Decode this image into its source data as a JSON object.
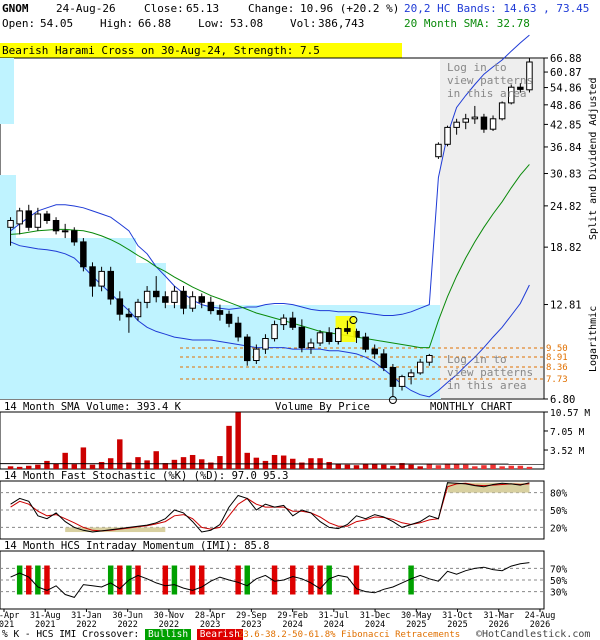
{
  "header": {
    "symbol": "GNOM",
    "date": "24-Aug-26",
    "close_label": "Close:",
    "close": "65.13",
    "change_label": "Change:",
    "change": "10.96 (+20.2 %)",
    "open_label": "Open:",
    "open": "54.05",
    "high_label": "High:",
    "high": "66.88",
    "low_label": "Low:",
    "low": "53.08",
    "vol_label": "Vol:",
    "vol": "386,743",
    "bands": "20,2 HC Bands: 14.63 , 73.45",
    "sma": "20 Month SMA: 32.78"
  },
  "colors": {
    "upper_band": "#1f3bd6",
    "lower_band": "#1f3bd6",
    "sma": "#0a8a0a",
    "up_candle": "#ffffff",
    "down_candle": "#000000",
    "volume_bar": "#cc0000",
    "cyan_zone": "#bff3ff",
    "bullish": "#00a000",
    "bearish": "#dd0000",
    "fib": "#e07000"
  },
  "alert": "Bearish Harami Cross on 30-Aug-24, Strength: 7.5",
  "main_panel": {
    "side_label": "Split and Dividend Adjusted",
    "log_label": "Logarithmic",
    "login_text_top": [
      "Log in to",
      "view patterns",
      "in this area"
    ],
    "login_text_bottom": [
      "Log in to",
      "view patterns",
      "in this area"
    ],
    "volume_by_price_label": "Volume By Price",
    "monthly_chart_label": "MONTHLY CHART",
    "fib_levels": [
      "9.50",
      "8.91",
      "8.36",
      "7.73"
    ]
  },
  "volume_panel": {
    "label": "14 Month SMA Volume: 393.4 K",
    "ticks": [
      "10.57 M",
      "7.05 M",
      "3.52 M"
    ]
  },
  "stoch_panel": {
    "label": "14 Month Fast Stochastic (%K) (%D): 97.0   95.3",
    "ticks": [
      "80%",
      "50%",
      "20%"
    ]
  },
  "imi_panel": {
    "label": "14 Month HCS Intraday Momentum (IMI): 85.8",
    "ticks": [
      "70%",
      "50%",
      "30%"
    ]
  },
  "x_axis": {
    "ticks": [
      "30-Apr\n2021",
      "31-Aug\n2021",
      "31-Jan\n2022",
      "30-Jun\n2022",
      "30-Nov\n2022",
      "28-Apr\n2023",
      "29-Sep\n2023",
      "29-Feb\n2024",
      "31-Jul\n2024",
      "31-Dec\n2024",
      "30-May\n2025",
      "31-Oct\n2025",
      "31-Mar\n2026",
      "24-Aug\n2026"
    ]
  },
  "footer": {
    "legend_text": "% K - HCS IMI Crossover:",
    "bullish": "Bullish",
    "bearish": "Bearish",
    "fib_text": "23.6-38.2-50-61.8% Fibonacci Retracements",
    "copyright": "©HotCandlestick.com"
  },
  "chart_data": {
    "type": "candlestick",
    "title": "GNOM",
    "scale": "logarithmic",
    "ylim": [
      6.8,
      66.88
    ],
    "y_ticks": [
      66.88,
      60.87,
      54.86,
      48.86,
      42.85,
      36.84,
      30.83,
      24.82,
      18.82,
      12.81,
      6.8
    ],
    "ohlc": [
      {
        "o": 21.5,
        "h": 23.0,
        "l": 19.0,
        "c": 22.5
      },
      {
        "o": 22.0,
        "h": 24.5,
        "l": 20.5,
        "c": 24.0
      },
      {
        "o": 24.0,
        "h": 25.0,
        "l": 21.0,
        "c": 21.5
      },
      {
        "o": 21.5,
        "h": 24.5,
        "l": 21.0,
        "c": 23.5
      },
      {
        "o": 23.5,
        "h": 24.0,
        "l": 22.0,
        "c": 22.5
      },
      {
        "o": 22.5,
        "h": 23.0,
        "l": 20.5,
        "c": 21.0
      },
      {
        "o": 21.0,
        "h": 22.0,
        "l": 20.0,
        "c": 21.0
      },
      {
        "o": 21.0,
        "h": 21.5,
        "l": 19.0,
        "c": 19.5
      },
      {
        "o": 19.5,
        "h": 20.0,
        "l": 16.0,
        "c": 16.5
      },
      {
        "o": 16.5,
        "h": 17.0,
        "l": 13.5,
        "c": 14.5
      },
      {
        "o": 14.5,
        "h": 16.5,
        "l": 14.0,
        "c": 16.0
      },
      {
        "o": 16.0,
        "h": 16.5,
        "l": 12.8,
        "c": 13.3
      },
      {
        "o": 13.3,
        "h": 14.0,
        "l": 11.5,
        "c": 12.0
      },
      {
        "o": 12.0,
        "h": 12.5,
        "l": 10.6,
        "c": 11.8
      },
      {
        "o": 11.8,
        "h": 13.3,
        "l": 11.5,
        "c": 13.0
      },
      {
        "o": 13.0,
        "h": 14.5,
        "l": 12.5,
        "c": 14.0
      },
      {
        "o": 14.0,
        "h": 15.5,
        "l": 13.0,
        "c": 13.5
      },
      {
        "o": 13.5,
        "h": 14.0,
        "l": 12.5,
        "c": 13.0
      },
      {
        "o": 13.0,
        "h": 14.5,
        "l": 12.5,
        "c": 14.0
      },
      {
        "o": 14.0,
        "h": 14.5,
        "l": 12.0,
        "c": 12.5
      },
      {
        "o": 12.5,
        "h": 14.0,
        "l": 12.2,
        "c": 13.5
      },
      {
        "o": 13.5,
        "h": 13.8,
        "l": 12.5,
        "c": 13.0
      },
      {
        "o": 13.0,
        "h": 13.5,
        "l": 12.0,
        "c": 12.3
      },
      {
        "o": 12.3,
        "h": 12.8,
        "l": 11.5,
        "c": 12.0
      },
      {
        "o": 12.0,
        "h": 12.3,
        "l": 11.0,
        "c": 11.3
      },
      {
        "o": 11.3,
        "h": 11.8,
        "l": 10.0,
        "c": 10.3
      },
      {
        "o": 10.3,
        "h": 10.5,
        "l": 8.5,
        "c": 8.8
      },
      {
        "o": 8.8,
        "h": 9.8,
        "l": 8.6,
        "c": 9.5
      },
      {
        "o": 9.5,
        "h": 10.5,
        "l": 9.2,
        "c": 10.2
      },
      {
        "o": 10.2,
        "h": 11.5,
        "l": 10.0,
        "c": 11.2
      },
      {
        "o": 11.2,
        "h": 12.0,
        "l": 10.8,
        "c": 11.7
      },
      {
        "o": 11.7,
        "h": 12.2,
        "l": 10.8,
        "c": 11.0
      },
      {
        "o": 11.0,
        "h": 11.6,
        "l": 9.3,
        "c": 9.6
      },
      {
        "o": 9.6,
        "h": 10.2,
        "l": 9.2,
        "c": 9.9
      },
      {
        "o": 9.9,
        "h": 10.8,
        "l": 9.7,
        "c": 10.6
      },
      {
        "o": 10.6,
        "h": 11.0,
        "l": 9.8,
        "c": 10.0
      },
      {
        "o": 10.0,
        "h": 11.0,
        "l": 9.8,
        "c": 10.9
      },
      {
        "o": 10.9,
        "h": 11.5,
        "l": 10.5,
        "c": 10.7
      },
      {
        "o": 10.7,
        "h": 10.9,
        "l": 9.9,
        "c": 10.3
      },
      {
        "o": 10.3,
        "h": 10.6,
        "l": 9.3,
        "c": 9.5
      },
      {
        "o": 9.5,
        "h": 9.8,
        "l": 8.9,
        "c": 9.2
      },
      {
        "o": 9.2,
        "h": 9.5,
        "l": 8.2,
        "c": 8.4
      },
      {
        "o": 8.4,
        "h": 8.6,
        "l": 6.9,
        "c": 7.4
      },
      {
        "o": 7.4,
        "h": 8.0,
        "l": 7.2,
        "c": 7.9
      },
      {
        "o": 7.9,
        "h": 8.3,
        "l": 7.5,
        "c": 8.1
      },
      {
        "o": 8.1,
        "h": 8.9,
        "l": 8.0,
        "c": 8.7
      },
      {
        "o": 8.7,
        "h": 9.2,
        "l": 8.5,
        "c": 9.1
      },
      {
        "o": 34.5,
        "h": 38.0,
        "l": 34.0,
        "c": 37.5
      },
      {
        "o": 37.5,
        "h": 42.5,
        "l": 37.0,
        "c": 42.0
      },
      {
        "o": 42.0,
        "h": 44.5,
        "l": 40.0,
        "c": 43.5
      },
      {
        "o": 43.5,
        "h": 46.0,
        "l": 41.5,
        "c": 44.5
      },
      {
        "o": 44.5,
        "h": 48.5,
        "l": 43.0,
        "c": 45.0
      },
      {
        "o": 45.0,
        "h": 46.0,
        "l": 40.5,
        "c": 41.5
      },
      {
        "o": 41.5,
        "h": 45.5,
        "l": 41.0,
        "c": 44.5
      },
      {
        "o": 44.5,
        "h": 50.0,
        "l": 44.0,
        "c": 49.5
      },
      {
        "o": 49.5,
        "h": 56.0,
        "l": 49.0,
        "c": 55.0
      },
      {
        "o": 55.0,
        "h": 56.5,
        "l": 53.0,
        "c": 54.2
      },
      {
        "o": 54.05,
        "h": 66.88,
        "l": 53.08,
        "c": 65.13
      }
    ],
    "volume_ylim": [
      0,
      10.57
    ],
    "volume": [
      0.5,
      0.4,
      0.6,
      0.8,
      1.5,
      1.0,
      3.0,
      0.9,
      4.0,
      0.8,
      1.3,
      2.0,
      5.5,
      1.2,
      2.2,
      1.6,
      3.3,
      1.1,
      1.7,
      2.2,
      2.6,
      1.8,
      1.2,
      2.4,
      8.0,
      10.5,
      3.0,
      2.1,
      1.5,
      2.6,
      2.5,
      1.9,
      1.2,
      2.0,
      2.0,
      1.3,
      1.0,
      0.8,
      0.7,
      0.9,
      1.0,
      0.8,
      0.6,
      1.1,
      0.8,
      0.5,
      1.0,
      0.7,
      1.0,
      0.9,
      0.8,
      0.5,
      0.7,
      0.8,
      0.5,
      0.6,
      0.6,
      0.4
    ],
    "stochastic_k": [
      60,
      70,
      65,
      40,
      35,
      45,
      30,
      20,
      15,
      12,
      14,
      16,
      18,
      20,
      22,
      24,
      28,
      35,
      50,
      45,
      30,
      12,
      15,
      25,
      55,
      75,
      70,
      50,
      60,
      55,
      58,
      40,
      50,
      45,
      30,
      20,
      18,
      25,
      40,
      35,
      42,
      38,
      30,
      20,
      25,
      30,
      40,
      35,
      97,
      96,
      95,
      92,
      90,
      94,
      96,
      95,
      93,
      97
    ],
    "stochastic_d": [
      55,
      65,
      60,
      48,
      40,
      42,
      35,
      28,
      20,
      15,
      14,
      15,
      17,
      19,
      21,
      23,
      26,
      30,
      40,
      42,
      35,
      20,
      17,
      20,
      40,
      60,
      70,
      60,
      55,
      55,
      55,
      48,
      48,
      45,
      38,
      28,
      22,
      22,
      30,
      33,
      38,
      37,
      34,
      28,
      25,
      28,
      33,
      35,
      90,
      95,
      96,
      93,
      92,
      93,
      94,
      95,
      94,
      95.3
    ],
    "imi": [
      55,
      62,
      55,
      38,
      32,
      40,
      25,
      20,
      42,
      40,
      38,
      45,
      35,
      50,
      58,
      52,
      45,
      40,
      42,
      36,
      32,
      38,
      48,
      55,
      50,
      46,
      40,
      52,
      58,
      48,
      50,
      56,
      52,
      45,
      35,
      52,
      58,
      55,
      35,
      30,
      28,
      34,
      38,
      45,
      52,
      58,
      52,
      48,
      65,
      60,
      66,
      70,
      72,
      68,
      66,
      74,
      78,
      80
    ],
    "bullish_months": [
      1,
      3,
      11,
      13,
      18,
      26,
      35,
      44
    ],
    "bearish_months": [
      2,
      4,
      12,
      14,
      17,
      20,
      21,
      25,
      29,
      31,
      33,
      34,
      38
    ]
  }
}
